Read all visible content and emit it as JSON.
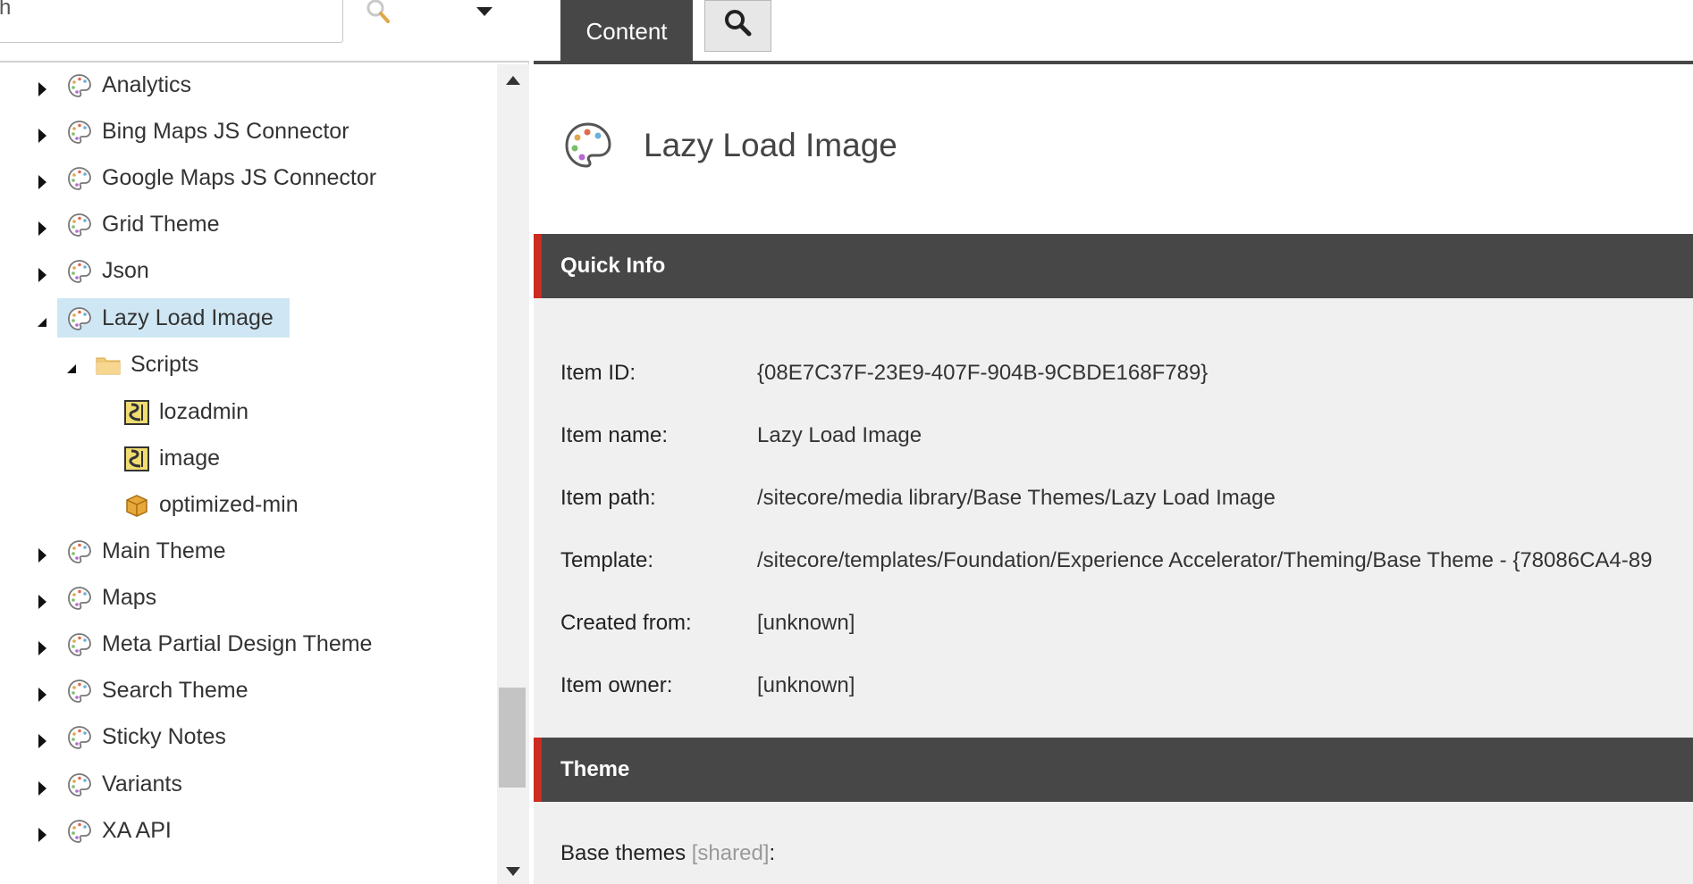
{
  "search": {
    "value": "h"
  },
  "tree": {
    "items": [
      {
        "label": "Analytics",
        "toggle": "collapsed",
        "icon": "palette-icon",
        "level": 0
      },
      {
        "label": "Bing Maps JS Connector",
        "toggle": "collapsed",
        "icon": "palette-icon",
        "level": 0
      },
      {
        "label": "Google Maps JS Connector",
        "toggle": "collapsed",
        "icon": "palette-icon",
        "level": 0
      },
      {
        "label": "Grid Theme",
        "toggle": "collapsed",
        "icon": "palette-icon",
        "level": 0
      },
      {
        "label": "Json",
        "toggle": "collapsed",
        "icon": "palette-icon",
        "level": 0
      },
      {
        "label": "Lazy Load Image",
        "toggle": "expanded",
        "icon": "palette-icon",
        "level": 0,
        "selected": true
      },
      {
        "label": "Scripts",
        "toggle": "expanded",
        "icon": "folder-icon",
        "level": 1
      },
      {
        "label": "lozadmin",
        "toggle": "none",
        "icon": "script-file-icon",
        "level": 2
      },
      {
        "label": "image",
        "toggle": "none",
        "icon": "script-file-icon",
        "level": 2
      },
      {
        "label": "optimized-min",
        "toggle": "none",
        "icon": "package-icon",
        "level": 2
      },
      {
        "label": "Main Theme",
        "toggle": "collapsed",
        "icon": "palette-icon",
        "level": 0
      },
      {
        "label": "Maps",
        "toggle": "collapsed",
        "icon": "palette-icon",
        "level": 0
      },
      {
        "label": "Meta Partial Design Theme",
        "toggle": "collapsed",
        "icon": "palette-icon",
        "level": 0
      },
      {
        "label": "Search Theme",
        "toggle": "collapsed",
        "icon": "palette-icon",
        "level": 0
      },
      {
        "label": "Sticky Notes",
        "toggle": "collapsed",
        "icon": "palette-icon",
        "level": 0
      },
      {
        "label": "Variants",
        "toggle": "collapsed",
        "icon": "palette-icon",
        "level": 0
      },
      {
        "label": "XA API",
        "toggle": "collapsed",
        "icon": "palette-icon",
        "level": 0
      }
    ]
  },
  "tabs": {
    "content": "Content"
  },
  "item": {
    "title": "Lazy Load Image"
  },
  "quick_info": {
    "title": "Quick Info",
    "fields": [
      {
        "key": "Item ID:",
        "value": "{08E7C37F-23E9-407F-904B-9CBDE168F789}"
      },
      {
        "key": "Item name:",
        "value": "Lazy Load Image"
      },
      {
        "key": "Item path:",
        "value": "/sitecore/media library/Base Themes/Lazy Load Image"
      },
      {
        "key": "Template:",
        "value": "/sitecore/templates/Foundation/Experience Accelerator/Theming/Base Theme - {78086CA4-89"
      },
      {
        "key": "Created from:",
        "value": "[unknown]"
      },
      {
        "key": "Item owner:",
        "value": "[unknown]"
      }
    ]
  },
  "theme": {
    "title": "Theme",
    "base_themes_label": "Base themes",
    "shared_tag": "[shared]",
    "colon": ":"
  },
  "colors": {
    "section_bg": "#474747",
    "accent": "#cc2b21",
    "selection": "#cfe7f4"
  }
}
